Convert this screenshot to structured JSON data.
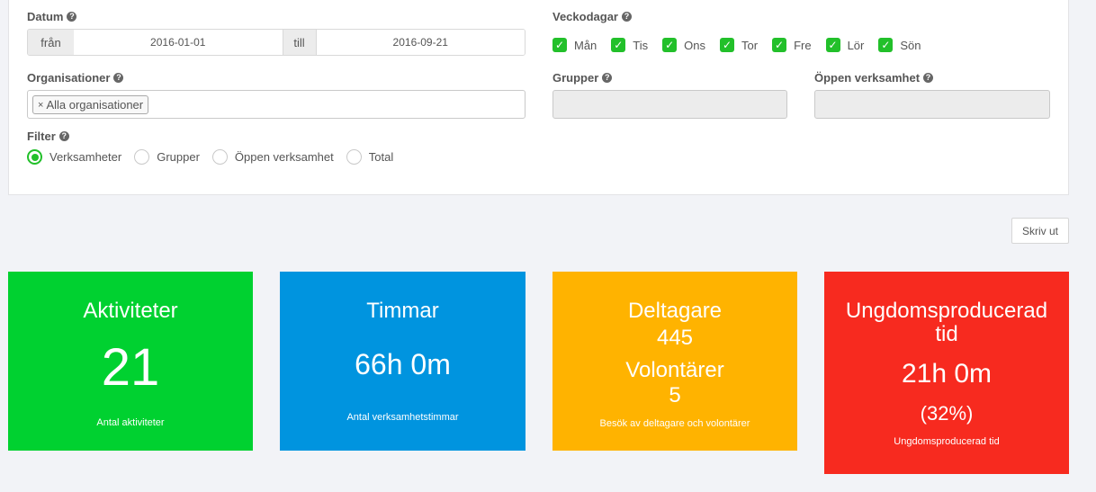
{
  "filters": {
    "date": {
      "label": "Datum",
      "from_label": "från",
      "from_value": "2016-01-01",
      "to_label": "till",
      "to_value": "2016-09-21"
    },
    "weekdays": {
      "label": "Veckodagar",
      "days": [
        {
          "label": "Mån",
          "checked": true
        },
        {
          "label": "Tis",
          "checked": true
        },
        {
          "label": "Ons",
          "checked": true
        },
        {
          "label": "Tor",
          "checked": true
        },
        {
          "label": "Fre",
          "checked": true
        },
        {
          "label": "Lör",
          "checked": true
        },
        {
          "label": "Sön",
          "checked": true
        }
      ]
    },
    "organisations": {
      "label": "Organisationer",
      "tag": "Alla organisationer",
      "tag_remove": "×"
    },
    "groups": {
      "label": "Grupper"
    },
    "open_activity": {
      "label": "Öppen verksamhet"
    },
    "filter": {
      "label": "Filter",
      "options": [
        {
          "label": "Verksamheter",
          "selected": true
        },
        {
          "label": "Grupper",
          "selected": false
        },
        {
          "label": "Öppen verksamhet",
          "selected": false
        },
        {
          "label": "Total",
          "selected": false
        }
      ]
    }
  },
  "print_button": "Skriv ut",
  "cards": {
    "activities": {
      "title": "Aktiviteter",
      "value": "21",
      "caption": "Antal aktiviteter",
      "color": "#00d130"
    },
    "hours": {
      "title": "Timmar",
      "value": "66h 0m",
      "caption": "Antal verksamhetstimmar",
      "color": "#0094df"
    },
    "participants": {
      "title": "Deltagare",
      "value": "445",
      "title2": "Volontärer",
      "value2": "5",
      "caption": "Besök av deltagare och volontärer",
      "color": "#ffb300"
    },
    "youth": {
      "title": "Ungdomsproducerad tid",
      "value": "21h 0m",
      "percent": "(32%)",
      "caption": "Ungdomsproducerad tid",
      "color": "#f72a1f"
    }
  },
  "colors": {
    "checkbox": "#22c02a",
    "background": "#f2f3f7"
  }
}
